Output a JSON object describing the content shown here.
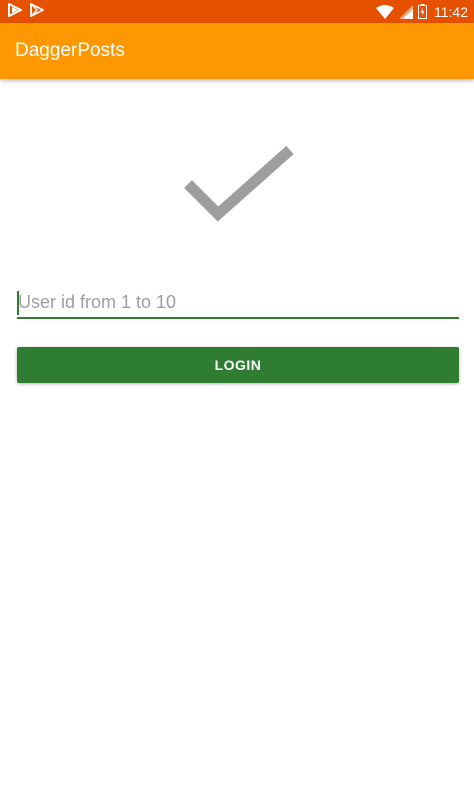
{
  "status_bar": {
    "time": "11:42",
    "left_icons": [
      "notification-app-icon",
      "play-store-icon"
    ],
    "right_icons": [
      "wifi-icon",
      "signal-icon",
      "battery-icon"
    ],
    "background_color": "#e65100"
  },
  "app_bar": {
    "title": "DaggerPosts",
    "background_color": "#ff9800"
  },
  "logo": {
    "icon": "checkmark-icon",
    "color": "#9e9e9e"
  },
  "login_form": {
    "user_id_value": "",
    "user_id_placeholder": "User id from 1 to 10",
    "login_label": "LOGIN",
    "accent_color": "#2e7d32"
  }
}
